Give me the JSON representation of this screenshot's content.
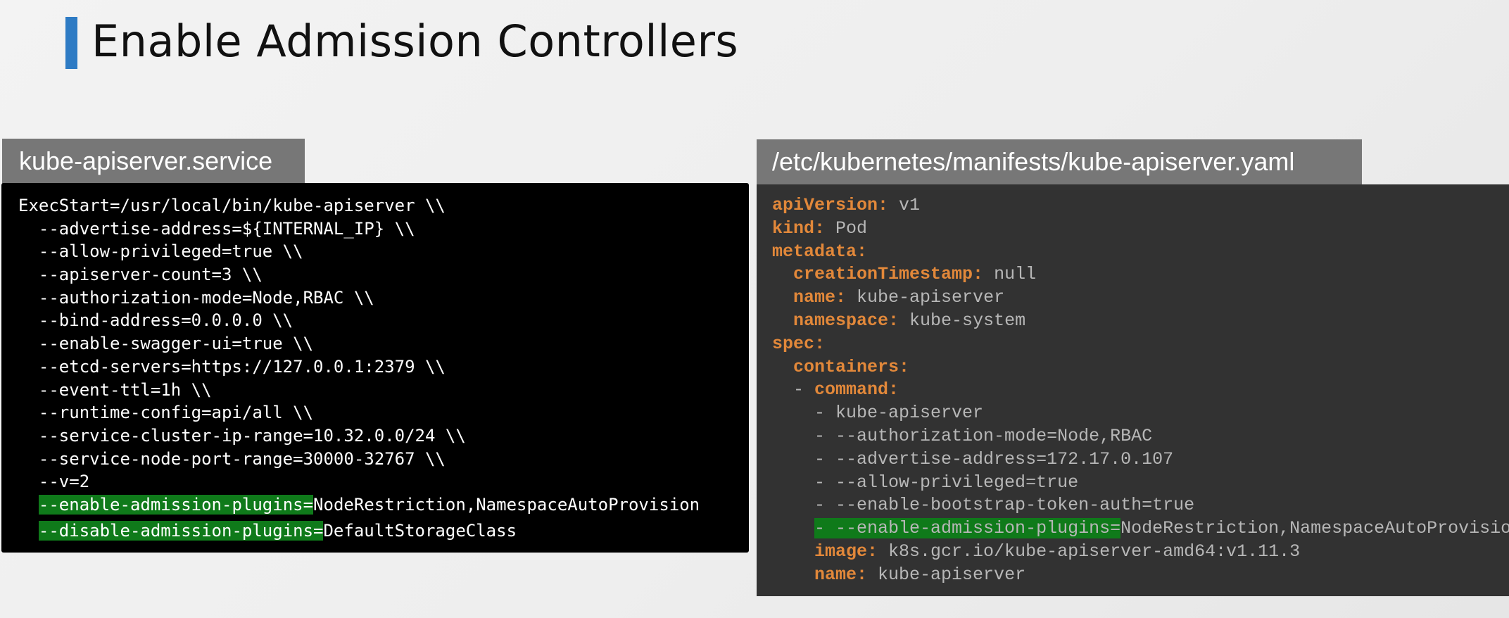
{
  "slide": {
    "title": "Enable Admission Controllers"
  },
  "left_panel": {
    "tab_label": "kube-apiserver.service",
    "lines": [
      "ExecStart=/usr/local/bin/kube-apiserver \\\\",
      "  --advertise-address=${INTERNAL_IP} \\\\",
      "  --allow-privileged=true \\\\",
      "  --apiserver-count=3 \\\\",
      "  --authorization-mode=Node,RBAC \\\\",
      "  --bind-address=0.0.0.0 \\\\",
      "  --enable-swagger-ui=true \\\\",
      "  --etcd-servers=https://127.0.0.1:2379 \\\\",
      "  --event-ttl=1h \\\\",
      "  --runtime-config=api/all \\\\",
      "  --service-cluster-ip-range=10.32.0.0/24 \\\\",
      "  --service-node-port-range=30000-32767 \\\\",
      "  --v=2"
    ],
    "enable_flag": "--enable-admission-plugins=",
    "enable_value": "NodeRestriction,NamespaceAutoProvision",
    "disable_flag": "--disable-admission-plugins=",
    "disable_value": "DefaultStorageClass"
  },
  "right_panel": {
    "tab_label": "/etc/kubernetes/manifests/kube-apiserver.yaml",
    "yaml": {
      "k_apiVersion": "apiVersion:",
      "v_apiVersion": " v1",
      "k_kind": "kind:",
      "v_kind": " Pod",
      "k_metadata": "metadata:",
      "k_creationTimestamp": "creationTimestamp:",
      "v_creationTimestamp": " null",
      "k_name": "name:",
      "v_name": " kube-apiserver",
      "k_namespace": "namespace:",
      "v_namespace": " kube-system",
      "k_spec": "spec:",
      "k_containers": "containers:",
      "dash_command": "- ",
      "k_command": "command:",
      "command_items": [
        "- kube-apiserver",
        "- --authorization-mode=Node,RBAC",
        "- --advertise-address=172.17.0.107",
        "- --allow-privileged=true",
        "- --enable-bootstrap-token-auth=true"
      ],
      "enable_flag": "- --enable-admission-plugins=",
      "enable_value": "NodeRestriction,NamespaceAutoProvision",
      "k_image": "image:",
      "v_image": " k8s.gcr.io/kube-apiserver-amd64:v1.11.3",
      "k_container_name": "name:",
      "v_container_name": " kube-apiserver"
    }
  },
  "colors": {
    "accent_bar": "#2e7bc4",
    "highlight": "#0f7a1a",
    "yaml_key": "#e2883a",
    "tab_bg": "#777777"
  }
}
